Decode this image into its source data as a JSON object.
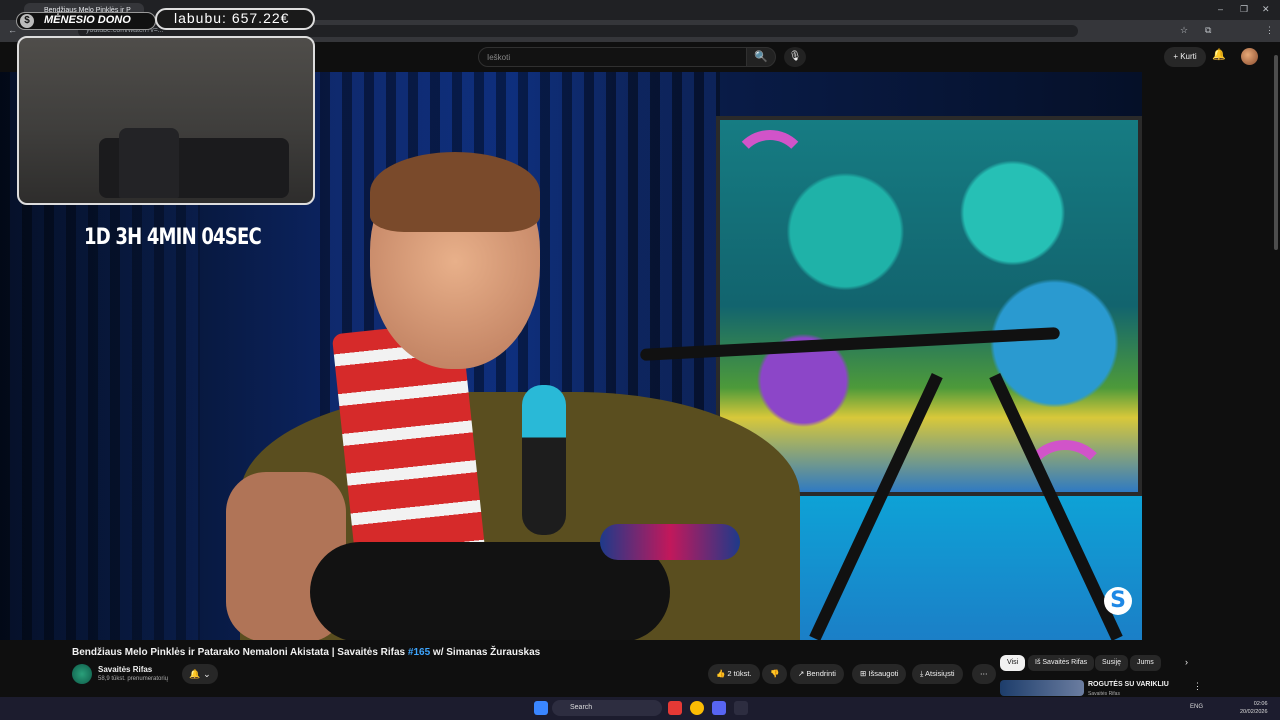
{
  "browser": {
    "tab_title": "Bendžiaus Melo Pinklės ir P",
    "url": "youtube.com/watch?v=...",
    "win_controls": [
      "–",
      "❐",
      "✕"
    ]
  },
  "youtube": {
    "search_placeholder": "Ieškoti",
    "create_label": "Kurti",
    "icons": {
      "search": "🔍",
      "mic": "🎙",
      "bell": "🔔"
    }
  },
  "overlay": {
    "donate_label": "MĖNESIO DONO",
    "donate_icon": "$",
    "price_label": "labubu: 657.22€",
    "timer": "1D 3H 4MIN 04SEC"
  },
  "video": {
    "title_pre": "Bendžiaus Melo Pinklės ir Patarako Nemaloni Akistata | Savaitės Rifas ",
    "title_hash": "#165",
    "title_post": " w/ Simanas Žurauskas",
    "channel_name": "Savaitės Rifas",
    "channel_subs": "58,9 tūkst. prenumeratorių",
    "bell_btn": "🔔",
    "actions": {
      "like": "👍 2 tūkst.",
      "dislike": "👎",
      "share": "↗ Bendrinti",
      "save": "⊞ Išsaugoti",
      "download": "⤓ Atsisiųsti",
      "more": "⋯"
    }
  },
  "chips": [
    "Visi",
    "Iš Savaitės Rifas",
    "Susiję",
    "Jums"
  ],
  "recommendation": {
    "title": "ROGUTĖS SU VARIKLIU",
    "sub": "Savaitės Rifas"
  },
  "taskbar": {
    "search_label": "Search",
    "lang": "ENG",
    "time": "02:06",
    "date": "20/02/2026"
  }
}
